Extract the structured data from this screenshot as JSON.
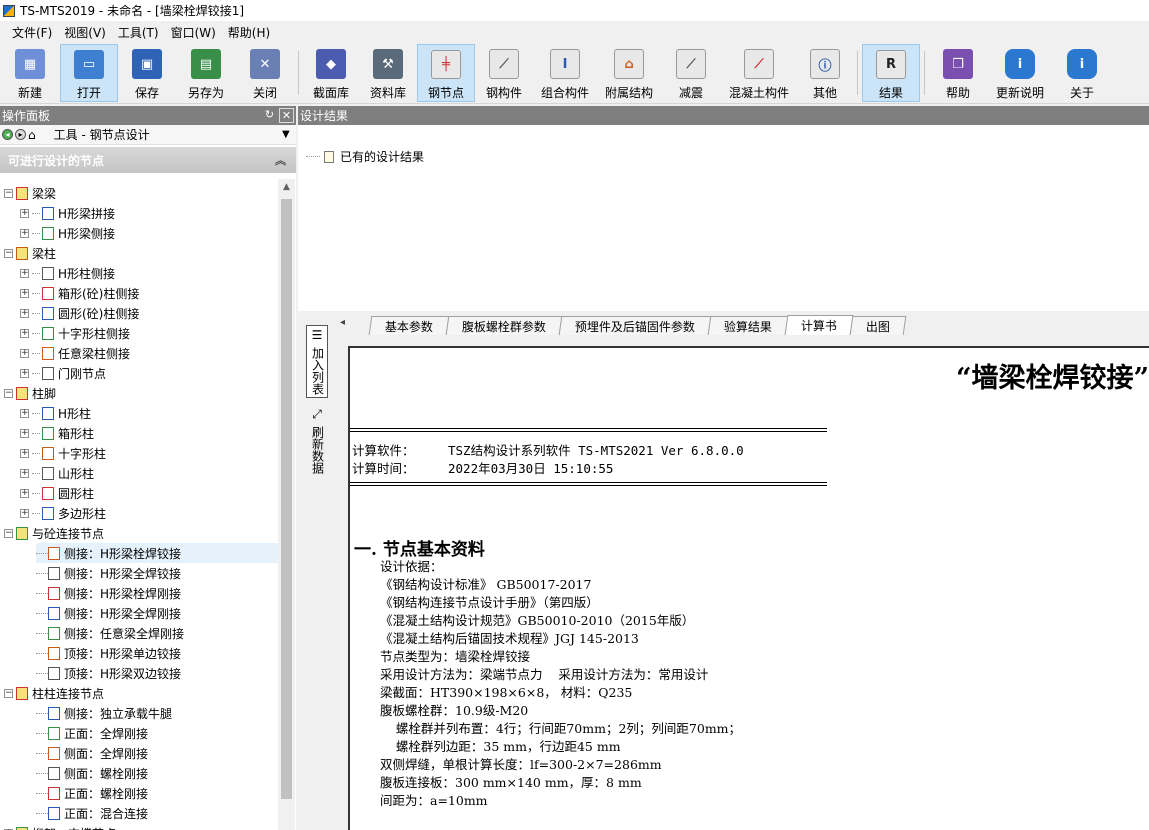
{
  "window": {
    "title": "TS-MTS2019 - 未命名 - [墙梁栓焊铰接1]"
  },
  "menu": [
    "文件(F)",
    "视图(V)",
    "工具(T)",
    "窗口(W)",
    "帮助(H)"
  ],
  "toolbar": {
    "new": "新建",
    "open": "打开",
    "save": "保存",
    "saveas": "另存为",
    "close": "关闭",
    "section_lib": "截面库",
    "data_lib": "资料库",
    "steel_node": "钢节点",
    "steel_member": "钢构件",
    "combo_member": "组合构件",
    "attached": "附属结构",
    "damping": "减震",
    "concrete": "混凝土构件",
    "other": "其他",
    "result": "结果",
    "help": "帮助",
    "update": "更新说明",
    "about": "关于"
  },
  "left_panel": {
    "title": "操作面板",
    "selector": "工具 - 钢节点设计",
    "section": "可进行设计的节点",
    "tree": [
      {
        "label": "梁梁",
        "level": 0,
        "exp": "−"
      },
      {
        "label": "H形梁拼接",
        "level": 1,
        "exp": "+"
      },
      {
        "label": "H形梁侧接",
        "level": 1,
        "exp": "+"
      },
      {
        "label": "梁柱",
        "level": 0,
        "exp": "−"
      },
      {
        "label": "H形柱侧接",
        "level": 1,
        "exp": "+"
      },
      {
        "label": "箱形(砼)柱侧接",
        "level": 1,
        "exp": "+"
      },
      {
        "label": "圆形(砼)柱侧接",
        "level": 1,
        "exp": "+"
      },
      {
        "label": "十字形柱侧接",
        "level": 1,
        "exp": "+"
      },
      {
        "label": "任意梁柱侧接",
        "level": 1,
        "exp": "+"
      },
      {
        "label": "门刚节点",
        "level": 1,
        "exp": "+"
      },
      {
        "label": "柱脚",
        "level": 0,
        "exp": "−"
      },
      {
        "label": "H形柱",
        "level": 1,
        "exp": "+"
      },
      {
        "label": "箱形柱",
        "level": 1,
        "exp": "+"
      },
      {
        "label": "十字形柱",
        "level": 1,
        "exp": "+"
      },
      {
        "label": "山形柱",
        "level": 1,
        "exp": "+"
      },
      {
        "label": "圆形柱",
        "level": 1,
        "exp": "+"
      },
      {
        "label": "多边形柱",
        "level": 1,
        "exp": "+"
      },
      {
        "label": "与砼连接节点",
        "level": 0,
        "exp": "−"
      },
      {
        "label": "侧接：H形梁栓焊铰接",
        "level": 2,
        "exp": ""
      },
      {
        "label": "侧接：H形梁全焊铰接",
        "level": 2,
        "exp": ""
      },
      {
        "label": "侧接：H形梁栓焊刚接",
        "level": 2,
        "exp": ""
      },
      {
        "label": "侧接：H形梁全焊刚接",
        "level": 2,
        "exp": ""
      },
      {
        "label": "侧接：任意梁全焊刚接",
        "level": 2,
        "exp": ""
      },
      {
        "label": "顶接：H形梁单边铰接",
        "level": 2,
        "exp": ""
      },
      {
        "label": "顶接：H形梁双边铰接",
        "level": 2,
        "exp": ""
      },
      {
        "label": "柱柱连接节点",
        "level": 0,
        "exp": "−"
      },
      {
        "label": "侧接：独立承载牛腿",
        "level": 2,
        "exp": ""
      },
      {
        "label": "正面：全焊刚接",
        "level": 2,
        "exp": ""
      },
      {
        "label": "侧面：全焊刚接",
        "level": 2,
        "exp": ""
      },
      {
        "label": "侧面：螺栓刚接",
        "level": 2,
        "exp": ""
      },
      {
        "label": "正面：螺栓刚接",
        "level": 2,
        "exp": ""
      },
      {
        "label": "正面：混合连接",
        "level": 2,
        "exp": ""
      },
      {
        "label": "桁架、支撑节点",
        "level": 0,
        "exp": "+"
      }
    ]
  },
  "right_panel": {
    "title": "设计结果",
    "existing": "已有的设计结果",
    "tabs": [
      "基本参数",
      "腹板螺栓群参数",
      "预埋件及后锚固件参数",
      "验算结果",
      "计算书",
      "出图"
    ],
    "side_buttons": {
      "add": "加入列表",
      "refresh": "刷新数据"
    }
  },
  "document": {
    "title": "“墙梁栓焊铰接”",
    "software_label": "计算软件：",
    "software": "TSZ结构设计系列软件 TS-MTS2021 Ver 6.8.0.0",
    "time_label": "计算时间：",
    "time": "2022年03月30日 15:10:55",
    "section1": "一.  节点基本资料",
    "lines": [
      "设计依据：",
      "《钢结构设计标准》 GB50017-2017",
      "《钢结构连接节点设计手册》（第四版）",
      "《混凝土结构设计规范》GB50010-2010（2015年版）",
      "《混凝土结构后锚固技术规程》JGJ 145-2013",
      "节点类型为：墙梁栓焊铰接",
      "采用设计方法为：梁端节点力    采用设计方法为：常用设计",
      "梁截面：HT390×198×6×8， 材料：Q235",
      "腹板螺栓群：10.9级-M20",
      "    螺栓群并列布置：4行；行间距70mm；2列；列间距70mm；",
      "    螺栓群列边距：35 mm，行边距45 mm",
      "双侧焊缝，单根计算长度：lf=300-2×7=286mm",
      "腹板连接板：300 mm×140 mm，厚：8 mm",
      "间距为：a=10mm"
    ]
  }
}
